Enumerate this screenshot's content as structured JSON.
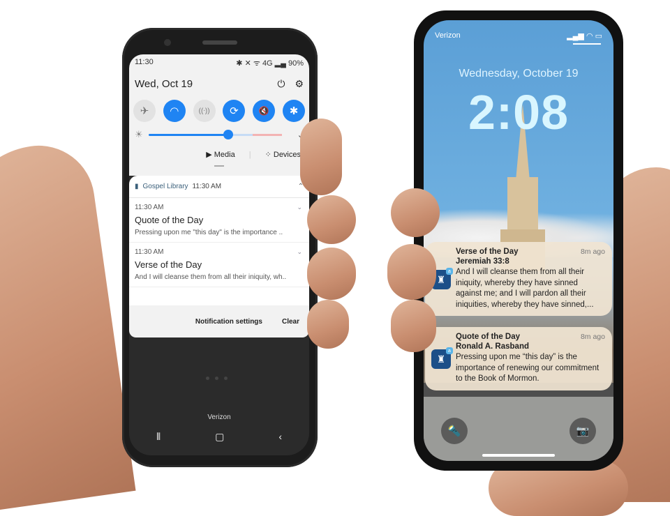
{
  "android": {
    "status_time": "11:30",
    "status_icons": "✱ ✕ ᯤ 4G ▂▄ 90%",
    "date": "Wed, Oct 19",
    "power_icon": "⏻",
    "settings_icon": "⚙",
    "toggles": [
      {
        "name": "airplane",
        "glyph": "✈",
        "on": false
      },
      {
        "name": "wifi",
        "glyph": "◠",
        "on": true
      },
      {
        "name": "hotspot",
        "glyph": "((ᐧ))",
        "on": false
      },
      {
        "name": "auto-rotate",
        "glyph": "⟳",
        "on": true
      },
      {
        "name": "mute",
        "glyph": "🔇",
        "on": true
      },
      {
        "name": "bluetooth",
        "glyph": "✱",
        "on": true
      }
    ],
    "brightness_percent": 60,
    "media_label": "Media",
    "devices_label": "Devices",
    "notification_app": "Gospel Library",
    "notification_app_time": "11:30 AM",
    "notifications": [
      {
        "time": "11:30 AM",
        "title": "Quote of the Day",
        "body": "Pressing upon me \"this day\" is the importance .."
      },
      {
        "time": "11:30 AM",
        "title": "Verse of the Day",
        "body": "And I will cleanse them from all their iniquity, wh.."
      }
    ],
    "notification_settings": "Notification settings",
    "clear": "Clear",
    "carrier": "Verizon"
  },
  "iphone": {
    "carrier": "Verizon",
    "date": "Wednesday, October 19",
    "time": "2:08",
    "notifications": [
      {
        "title": "Verse of the Day",
        "ago": "8m ago",
        "subtitle": "Jeremiah 33:8",
        "body": "And I will cleanse them from all their iniquity, whereby they have sinned against me; and I will pardon all their iniquities, whereby they have sinned,..."
      },
      {
        "title": "Quote of the Day",
        "ago": "8m ago",
        "subtitle": "Ronald A. Rasband",
        "body": "Pressing upon me “this day” is the importance of renewing our commitment to the Book of Mormon."
      }
    ]
  }
}
